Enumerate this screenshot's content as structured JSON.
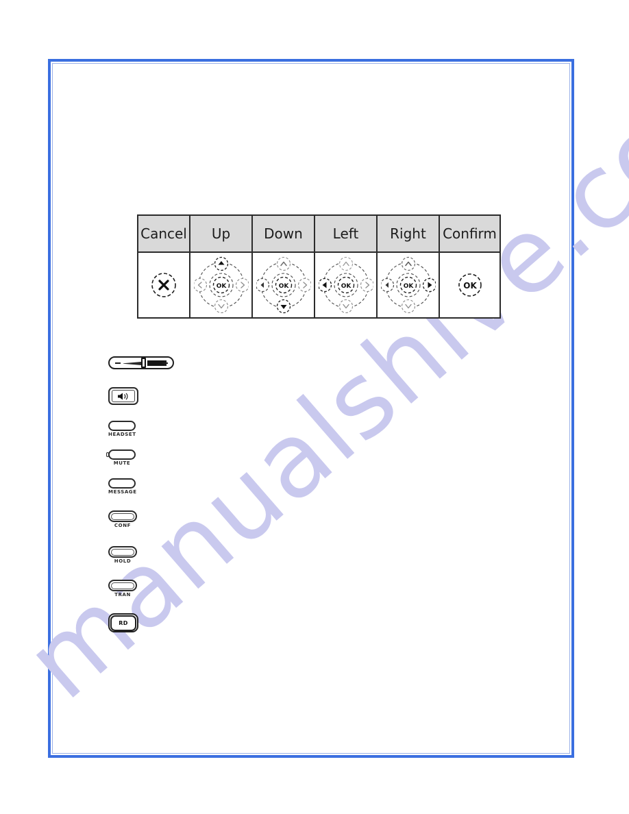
{
  "document": {
    "kind": "scanned-manual-page",
    "frame_color": "#3b6fe0",
    "watermark": "manualshive.com",
    "watermark_color": "#c9c9ee"
  },
  "nav_table": {
    "header_bg": "#d9d9d9",
    "columns": [
      {
        "label": "Cancel",
        "key": "cancel",
        "icon": "cancel-circle-x-icon",
        "glyph": "✕"
      },
      {
        "label": "Up",
        "key": "up",
        "icon": "navpad-up-icon",
        "glyph": "▲"
      },
      {
        "label": "Down",
        "key": "down",
        "icon": "navpad-down-icon",
        "glyph": "▼"
      },
      {
        "label": "Left",
        "key": "left",
        "icon": "navpad-left-icon",
        "glyph": "◀"
      },
      {
        "label": "Right",
        "key": "right",
        "icon": "navpad-right-icon",
        "glyph": "▶"
      },
      {
        "label": "Confirm",
        "key": "confirm",
        "icon": "confirm-circle-ok-icon",
        "glyph": "OK"
      }
    ],
    "navpad": {
      "center_label": "OK",
      "arrow_up": "∧",
      "arrow_down": "∨",
      "arrow_left": "‹",
      "arrow_right": "›"
    },
    "cancel_glyph": "✕",
    "confirm_glyph": "OK"
  },
  "key_list": {
    "items": [
      {
        "caption": "",
        "icon": "volume-rocker-icon",
        "minus": "−",
        "plus": "+"
      },
      {
        "caption": "",
        "icon": "speakerphone-icon",
        "glyph": "🔊"
      },
      {
        "caption": "HEADSET",
        "icon": "headset-key-icon"
      },
      {
        "caption": "MUTE",
        "icon": "mute-key-icon"
      },
      {
        "caption": "MESSAGE",
        "icon": "message-key-icon"
      },
      {
        "caption": "CONF",
        "icon": "conference-key-icon"
      },
      {
        "caption": "HOLD",
        "icon": "hold-key-icon"
      },
      {
        "caption": "TRAN",
        "icon": "transfer-key-icon"
      },
      {
        "caption": "RD",
        "icon": "redial-key-icon",
        "label": "RD"
      }
    ]
  }
}
